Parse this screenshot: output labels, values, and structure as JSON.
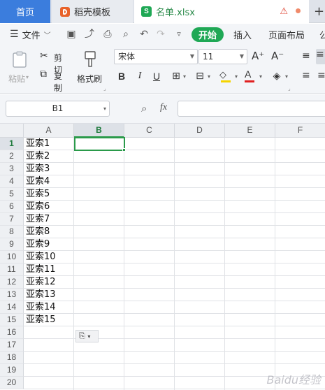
{
  "tabs": {
    "home": "首页",
    "daoke": "稻壳模板",
    "file": "名单.xlsx",
    "plus": "+"
  },
  "menu": {
    "file": "文件",
    "start": "开始",
    "insert": "插入",
    "page_layout": "页面布局",
    "formula_partial": "公"
  },
  "ribbon": {
    "paste": "粘贴",
    "cut": "剪切",
    "copy": "复制",
    "format_painter": "格式刷",
    "font_name": "宋体",
    "font_size": "11",
    "bold": "B",
    "italic": "I",
    "underline": "U"
  },
  "formula_bar": {
    "cell_ref": "B1",
    "fx": "fx"
  },
  "grid": {
    "columns": [
      "A",
      "B",
      "C",
      "D",
      "E",
      "F"
    ],
    "selected_column": "B",
    "rows": [
      "1",
      "2",
      "3",
      "4",
      "5",
      "6",
      "7",
      "8",
      "9",
      "10",
      "11",
      "12",
      "13",
      "14",
      "15",
      "16",
      "17",
      "18",
      "19",
      "20"
    ],
    "column_a_values": [
      "亚索1",
      "亚索2",
      "亚索3",
      "亚索4",
      "亚索5",
      "亚索6",
      "亚索7",
      "亚索8",
      "亚索9",
      "亚索10",
      "亚索11",
      "亚索12",
      "亚索13",
      "亚索14",
      "亚索15"
    ]
  },
  "colors": {
    "accent_green": "#1fa855",
    "home_tab_blue": "#3b7ddd"
  },
  "watermark": "Baidu经验"
}
